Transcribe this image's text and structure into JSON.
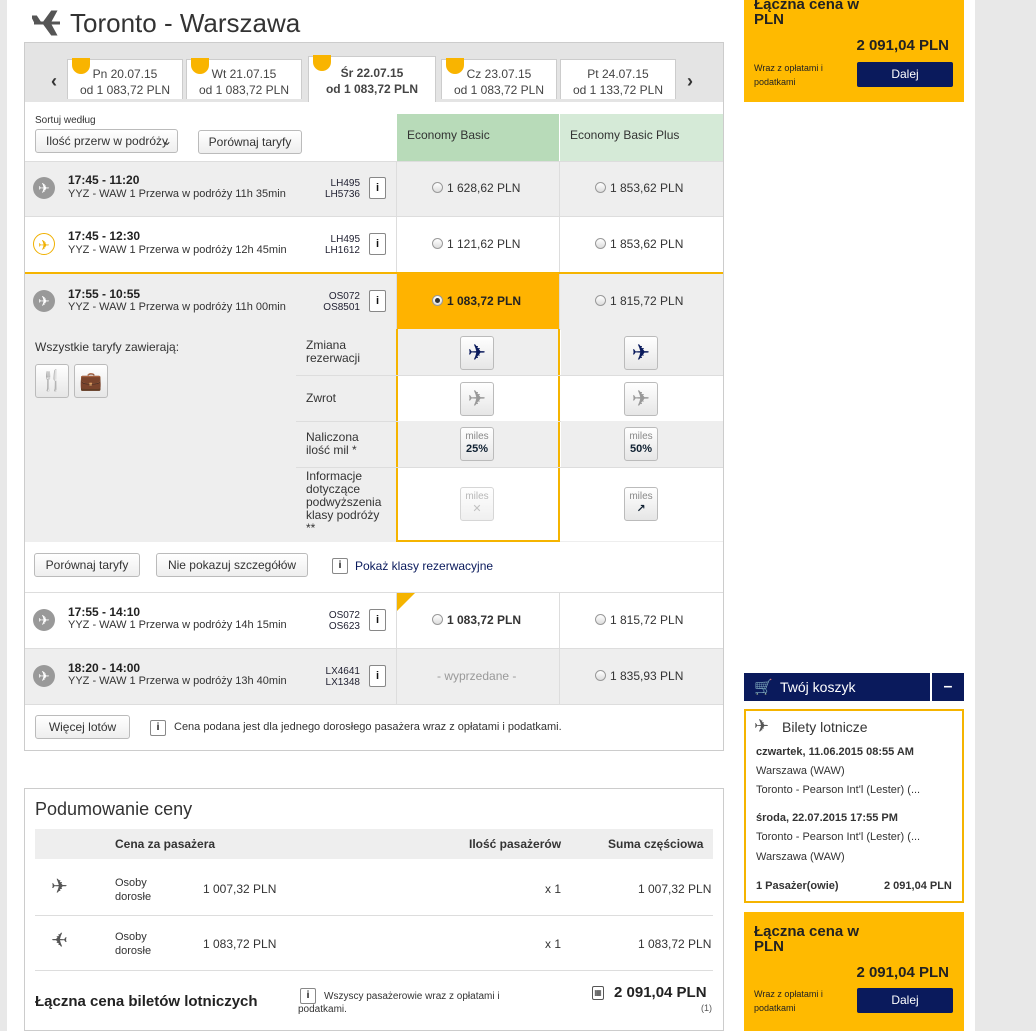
{
  "page_title": "Toronto - Warszawa",
  "date_tabs": [
    {
      "day": "Pn 20.07.15",
      "price": "od 1 083,72 PLN"
    },
    {
      "day": "Wt 21.07.15",
      "price": "od 1 083,72 PLN"
    },
    {
      "day": "Śr 22.07.15",
      "price": "od 1 083,72 PLN"
    },
    {
      "day": "Cz 23.07.15",
      "price": "od 1 083,72 PLN"
    },
    {
      "day": "Pt 24.07.15",
      "price": "od 1 133,72 PLN"
    }
  ],
  "sort": {
    "label": "Sortuj według",
    "selected": "Ilość przerw w podróży",
    "compare_label": "Porównaj taryfy"
  },
  "fare_headers": [
    "Economy Basic",
    "Economy Basic Plus"
  ],
  "flights": [
    {
      "times": "17:45 - 11:20",
      "route": "YYZ - WAW  1 Przerwa w podróży  11h 35min",
      "fl1": "LH495",
      "fl2": "LH5736",
      "basic": "1 628,62 PLN",
      "plus": "1 853,62 PLN"
    },
    {
      "times": "17:45 - 12:30",
      "route": "YYZ - WAW  1 Przerwa w podróży  12h 45min",
      "fl1": "LH495",
      "fl2": "LH1612",
      "basic": "1 121,62 PLN",
      "plus": "1 853,62 PLN"
    },
    {
      "times": "17:55 - 10:55",
      "route": "YYZ - WAW  1 Przerwa w podróży  11h 00min",
      "fl1": "OS072",
      "fl2": "OS8501",
      "basic": "1 083,72 PLN",
      "plus": "1 815,72 PLN"
    },
    {
      "times": "17:55 - 14:10",
      "route": "YYZ - WAW  1 Przerwa w podróży  14h 15min",
      "fl1": "OS072",
      "fl2": "OS623",
      "basic": "1 083,72 PLN",
      "plus": "1 815,72 PLN"
    },
    {
      "times": "18:20 - 14:00",
      "route": "YYZ - WAW  1 Przerwa w podróży  13h 40min",
      "fl1": "LX4641",
      "fl2": "LX1348",
      "basic": "- wyprzedane -",
      "plus": "1 835,93 PLN"
    }
  ],
  "info_i": "i",
  "details": {
    "all_fares_include": "Wszystkie taryfy zawierają:",
    "features": [
      "Zmiana rezerwacji",
      "Zwrot",
      "Naliczona ilość mil *",
      "Informacje dotyczące podwyższenia klasy podróży **"
    ],
    "miles_word": "miles",
    "miles_basic": "25%",
    "miles_plus": "50%",
    "compare_btn": "Porównaj taryfy",
    "hide_btn": "Nie pokazuj szczegółów",
    "show_classes": "Pokaż klasy rezerwacyjne"
  },
  "footer": {
    "more_flights": "Więcej lotów",
    "note": "Cena podana jest dla jednego dorosłego pasażera wraz z opłatami i podatkami."
  },
  "summary": {
    "title": "Podumowanie ceny",
    "col_price": "Cena za pasażera",
    "col_count": "Ilość pasażerów",
    "col_sub": "Suma częściowa",
    "rows": [
      {
        "type": "Osoby dorosłe",
        "price": "1 007,32 PLN",
        "count": "x 1",
        "sub": "1 007,32 PLN"
      },
      {
        "type": "Osoby dorosłe",
        "price": "1 083,72 PLN",
        "count": "x 1",
        "sub": "1 083,72 PLN"
      }
    ],
    "total_label": "Łączna cena biletów lotniczych",
    "total_note": "Wszyscy pasażerowie wraz z opłatami i podatkami.",
    "total": "2 091,04 PLN",
    "total_count": "(1)"
  },
  "price_box": {
    "title": "Łączna cena w PLN",
    "total": "2 091,04 PLN",
    "small": "Wraz z opłatami i podatkami",
    "button": "Dalej"
  },
  "cart": {
    "title": "Twój koszyk",
    "minus": "–",
    "section": "Bilety lotnicze",
    "legs": [
      {
        "date": "czwartek, 11.06.2015 08:55 AM",
        "from": "Warszawa (WAW)",
        "to": "Toronto - Pearson Int'l (Lester) (..."
      },
      {
        "date": "środa, 22.07.2015 17:55 PM",
        "from": "Toronto - Pearson Int'l (Lester) (...",
        "to": "Warszawa (WAW)"
      }
    ],
    "pax": "1 Pasażer(owie)",
    "pax_total": "2 091,04 PLN"
  },
  "colors": {
    "accent": "#ffba00",
    "navy": "#0a1a5c",
    "basic_header": "#b8dbb9",
    "plus_header": "#d5ead7"
  }
}
